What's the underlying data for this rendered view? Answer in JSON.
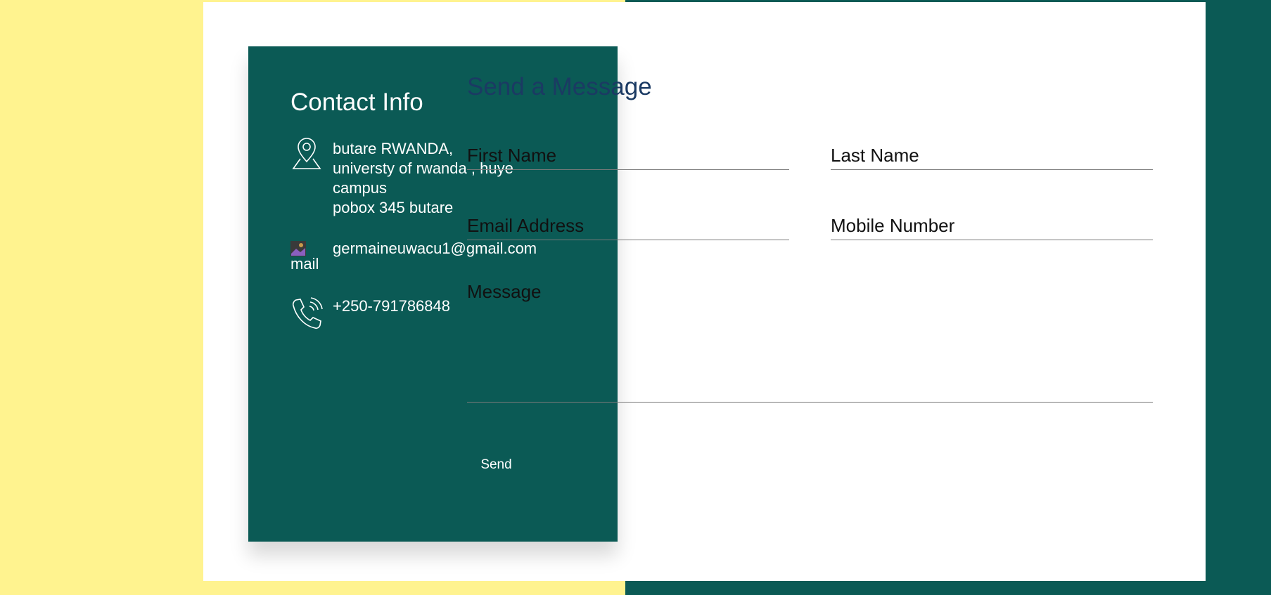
{
  "colors": {
    "yellow_bg": "#fff38f",
    "teal": "#0b5a55",
    "card_bg": "#ffffff",
    "title_blue": "#1b3a63"
  },
  "contact": {
    "title": "Contact Info",
    "address": {
      "icon": "location-pin-icon",
      "line1": "butare RWANDA,",
      "line2": "universty of rwanda , huye",
      "line3": "campus",
      "line4": "pobox 345 butare"
    },
    "email": {
      "icon_alt": "mail",
      "value": "germaineuwacu1@gmail.com"
    },
    "phone": {
      "icon": "phone-icon",
      "value": "+250-791786848"
    }
  },
  "form": {
    "title": "Send a Message",
    "first_name_placeholder": "First Name",
    "last_name_placeholder": "Last Name",
    "email_placeholder": "Email Address",
    "mobile_placeholder": "Mobile Number",
    "message_placeholder": "Message",
    "send_label": "Send"
  }
}
